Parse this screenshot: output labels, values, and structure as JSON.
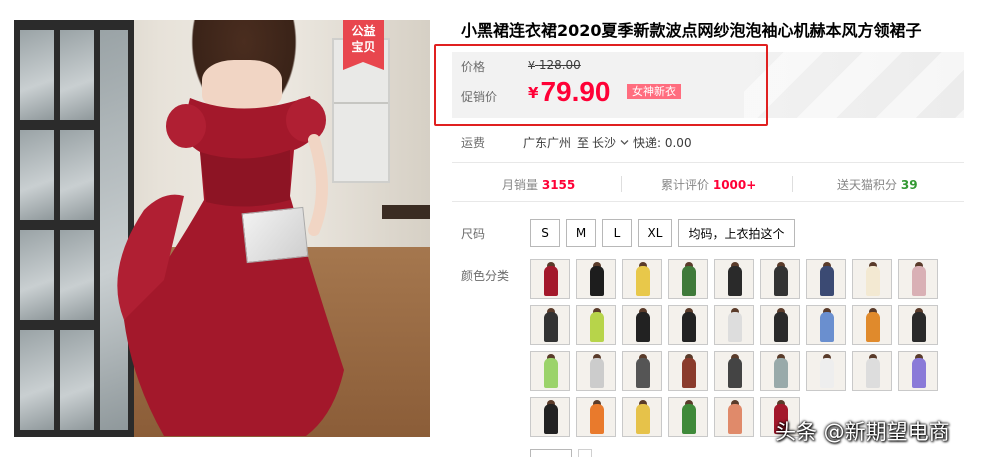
{
  "badge": {
    "line1": "公益",
    "line2": "宝贝"
  },
  "product": {
    "title": "小黑裙连衣裙2020夏季新款波点网纱泡泡袖心机赫本风方领裙子"
  },
  "price": {
    "label": "价格",
    "original_currency": "¥",
    "original_value": "128.00",
    "promo_label": "促销价",
    "promo_currency": "¥",
    "promo_value": "79.90",
    "promo_tag": "女神新衣",
    "accent_color": "#ff0036"
  },
  "shipping": {
    "label": "运费",
    "from": "广东广州",
    "to_word": "至",
    "destination": "长沙",
    "express": "快递: 0.00"
  },
  "stats": {
    "monthly_sales_label": "月销量",
    "monthly_sales_value": "3155",
    "reviews_label": "累计评价",
    "reviews_value": "1000+",
    "points_label": "送天猫积分",
    "points_value": "39"
  },
  "size": {
    "label": "尺码",
    "options": [
      "S",
      "M",
      "L",
      "XL",
      "均码，上衣拍这个"
    ]
  },
  "color": {
    "label": "颜色分类",
    "swatch_count": 33
  },
  "watermark": "头条 @新期望电商"
}
